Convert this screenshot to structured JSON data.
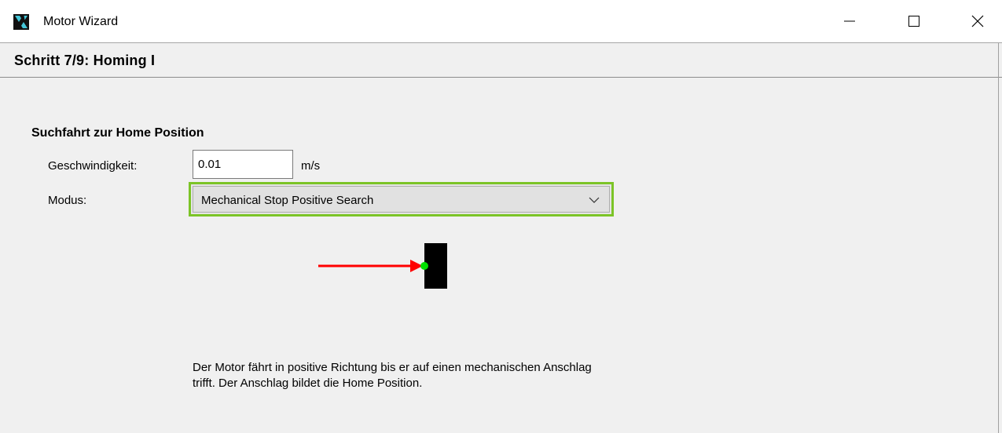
{
  "window": {
    "title": "Motor Wizard",
    "icon": "app-logo-icon",
    "controls": [
      "minimize-icon",
      "maximize-icon",
      "close-icon"
    ]
  },
  "step": {
    "title": "Schritt 7/9: Homing I"
  },
  "section": {
    "title": "Suchfahrt zur Home Position",
    "speed_label": "Geschwindigkeit:",
    "speed_value": "0.01",
    "speed_unit": "m/s",
    "mode_label": "Modus:",
    "mode_value": "Mechanical Stop Positive Search"
  },
  "description": "Der Motor fährt in positive Richtung bis er auf einen mechanischen Anschlag trifft. Der Anschlag bildet die Home Position.",
  "colors": {
    "highlight": "#7cc427",
    "arrow": "#ff0000",
    "home_point": "#00e000",
    "stop": "#000000"
  }
}
